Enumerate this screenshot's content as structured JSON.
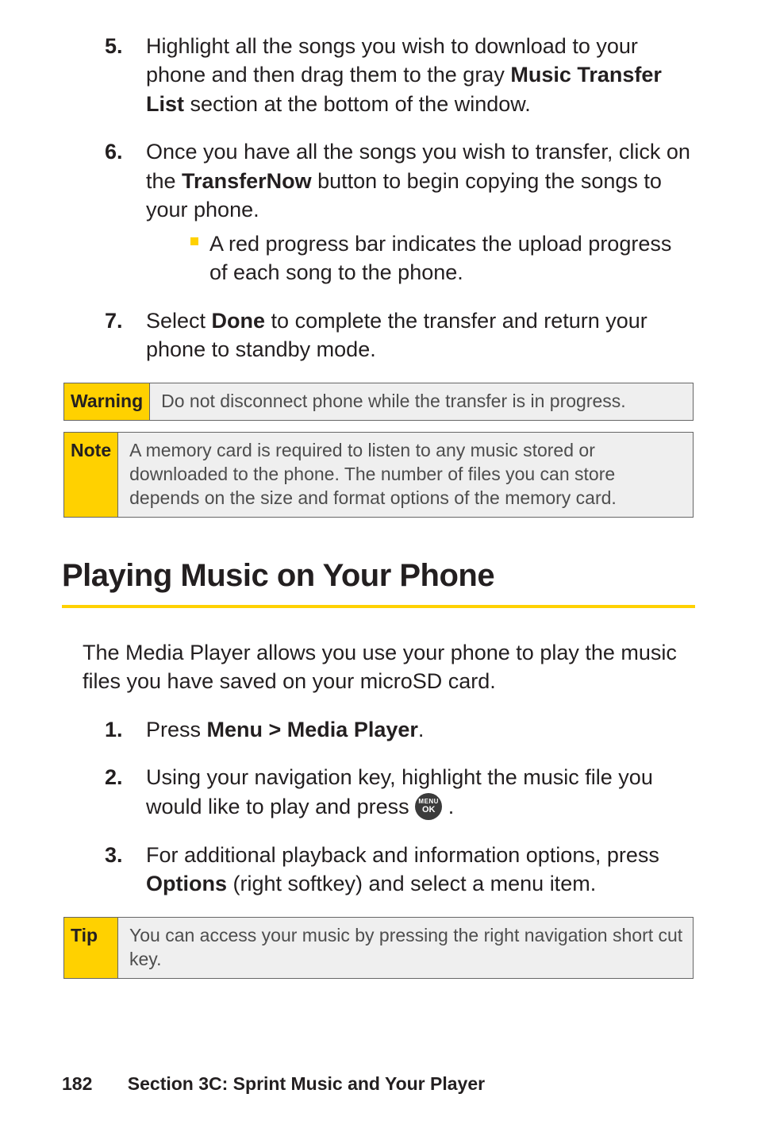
{
  "steps_a": [
    {
      "num": "5.",
      "html": "Highlight all the songs you wish to download to your phone and then drag them to the gray <strong>Music Transfer List</strong> section at the bottom of the window."
    },
    {
      "num": "6.",
      "html": "Once you have all the songs you wish to transfer, click on the <strong>TransferNow</strong> button to begin copying the songs to your phone.",
      "sub": "A red progress bar indicates the upload progress of each song to the phone."
    },
    {
      "num": "7.",
      "html": "Select <strong>Done</strong> to complete the transfer and return your phone to standby mode."
    }
  ],
  "warning_label": "Warning",
  "warning_body": "Do not disconnect phone while the transfer is in progress.",
  "note_label": "Note",
  "note_body": "A memory card is required to listen to any music stored or downloaded to the phone. The number of files you can store depends on the size and format options of the memory card.",
  "heading": "Playing Music on Your Phone",
  "intro": "The Media Player allows you use your phone to play the music files you have saved on your microSD card.",
  "steps_b": [
    {
      "num": "1.",
      "html": "Press <strong>Menu &gt; Media Player</strong>."
    },
    {
      "num": "2.",
      "html": "Using your navigation key, highlight the music file you would like to play and press <span class=\"menu-ok\" data-name=\"menu-ok-icon\" data-interactable=\"false\"><span class=\"m\">MENU</span><span class=\"ok\">OK</span></span> ."
    },
    {
      "num": "3.",
      "html": "For additional playback and information options, press <strong>Options</strong> (right softkey) and select a menu item."
    }
  ],
  "tip_label": "Tip",
  "tip_body": "You can access your music by pressing the right navigation short cut key.",
  "footer_page": "182",
  "footer_text": "Section 3C: Sprint Music and Your Player"
}
